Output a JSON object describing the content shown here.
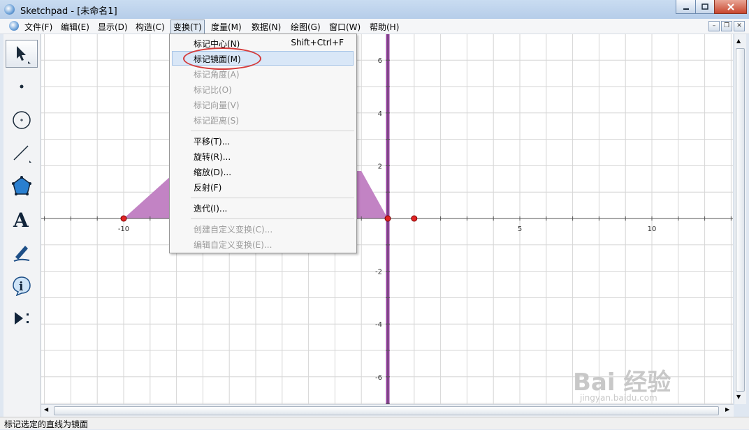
{
  "window": {
    "title": "Sketchpad - [未命名1]"
  },
  "menubar": {
    "items": [
      "文件(F)",
      "编辑(E)",
      "显示(D)",
      "构造(C)",
      "变换(T)",
      "度量(M)",
      "数据(N)",
      "绘图(G)",
      "窗口(W)",
      "帮助(H)"
    ],
    "active": "变换(T)"
  },
  "dropdown": {
    "items": [
      {
        "label": "标记中心(N)",
        "shortcut": "Shift+Ctrl+F",
        "enabled": true
      },
      {
        "label": "标记镜面(M)",
        "enabled": true,
        "highlighted": true
      },
      {
        "label": "标记角度(A)",
        "enabled": false
      },
      {
        "label": "标记比(O)",
        "enabled": false
      },
      {
        "label": "标记向量(V)",
        "enabled": false
      },
      {
        "label": "标记距离(S)",
        "enabled": false
      },
      {
        "label": "平移(T)...",
        "enabled": true
      },
      {
        "label": "旋转(R)...",
        "enabled": true
      },
      {
        "label": "缩放(D)...",
        "enabled": true
      },
      {
        "label": "反射(F)",
        "enabled": true
      },
      {
        "label": "迭代(I)...",
        "enabled": true
      },
      {
        "label": "创建自定义变换(C)...",
        "enabled": false
      },
      {
        "label": "编辑自定义变换(E)...",
        "enabled": false
      }
    ]
  },
  "toolbox": {
    "tools": [
      "arrow-tool",
      "point-tool",
      "compass-tool",
      "straightedge-tool",
      "polygon-tool",
      "text-tool",
      "marker-tool",
      "information-tool",
      "custom-tool"
    ]
  },
  "graph": {
    "x_ticks": [
      "-10",
      "5",
      "10"
    ],
    "y_ticks": [
      "6",
      "4",
      "2",
      "-2",
      "-4",
      "-6"
    ],
    "points": [
      {
        "x": -10,
        "y": 0
      },
      {
        "x": 0,
        "y": 0
      },
      {
        "x": 1,
        "y": 0
      }
    ],
    "mirror_line_x": 0,
    "polygon_color": "#c283c4",
    "mirror_color": "#9b3fa6",
    "point_color": "#e02424"
  },
  "status": {
    "text": "标记选定的直线为镜面"
  },
  "watermark": {
    "logo": "Bai 经验",
    "url": "jingyan.baidu.com"
  }
}
